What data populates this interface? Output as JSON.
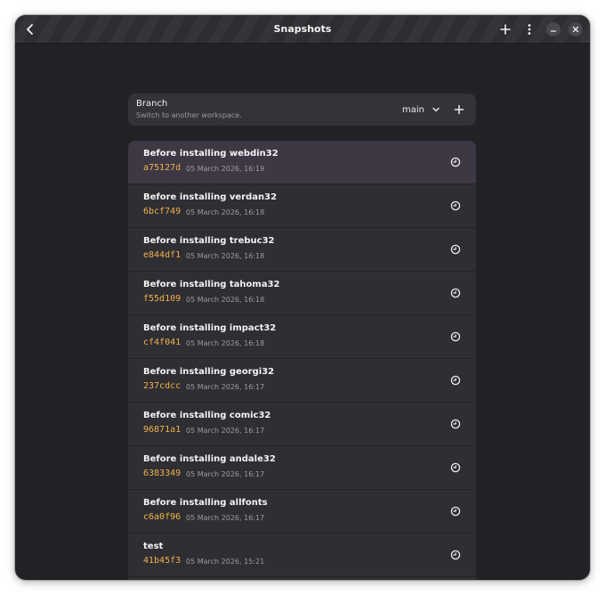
{
  "window": {
    "title": "Snapshots"
  },
  "branch": {
    "title": "Branch",
    "subtitle": "Switch to another workspace.",
    "selected": "main"
  },
  "snapshots": [
    {
      "title": "Before installing webdin32",
      "hash": "a75127d",
      "date": "05 March 2026, 16:19",
      "selected": true
    },
    {
      "title": "Before installing verdan32",
      "hash": "6bcf749",
      "date": "05 March 2026, 16:18",
      "selected": false
    },
    {
      "title": "Before installing trebuc32",
      "hash": "e844df1",
      "date": "05 March 2026, 16:18",
      "selected": false
    },
    {
      "title": "Before installing tahoma32",
      "hash": "f55d109",
      "date": "05 March 2026, 16:18",
      "selected": false
    },
    {
      "title": "Before installing impact32",
      "hash": "cf4f041",
      "date": "05 March 2026, 16:18",
      "selected": false
    },
    {
      "title": "Before installing georgi32",
      "hash": "237cdcc",
      "date": "05 March 2026, 16:17",
      "selected": false
    },
    {
      "title": "Before installing comic32",
      "hash": "96871a1",
      "date": "05 March 2026, 16:17",
      "selected": false
    },
    {
      "title": "Before installing andale32",
      "hash": "6383349",
      "date": "05 March 2026, 16:17",
      "selected": false
    },
    {
      "title": "Before installing allfonts",
      "hash": "c6a0f96",
      "date": "05 March 2026, 16:17",
      "selected": false
    },
    {
      "title": "test",
      "hash": "41b45f3",
      "date": "05 March 2026, 15:21",
      "selected": false
    }
  ],
  "icons": {
    "back": "back-arrow-icon",
    "add": "plus-icon",
    "menu": "vertical-dots-icon",
    "minimize": "minimize-icon",
    "close": "close-icon",
    "dropdown": "chevron-down-icon",
    "restore": "restore-clock-icon"
  },
  "colors": {
    "window_bg": "#222226",
    "card_bg": "#333338",
    "selected_row": "#3d3844",
    "hash": "#f2b24c"
  }
}
